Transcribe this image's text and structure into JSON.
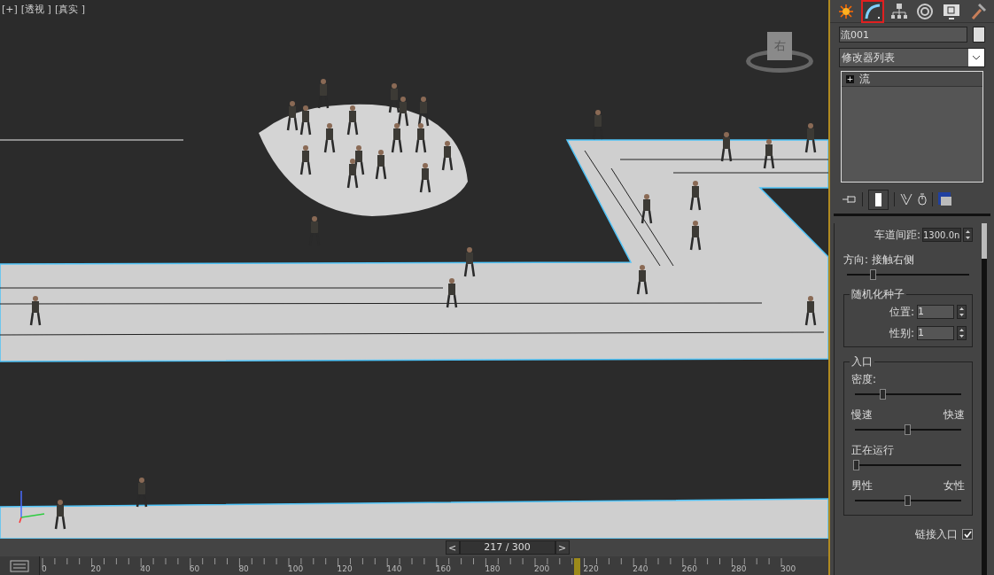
{
  "viewport": {
    "labels": [
      "[+]",
      "[透视 ]",
      "[真实 ]"
    ],
    "viewcube_label": "右"
  },
  "command_panel": {
    "tabs": [
      {
        "kind": "create",
        "selected": false
      },
      {
        "kind": "modify",
        "selected": true
      },
      {
        "kind": "hierarchy",
        "selected": false
      },
      {
        "kind": "motion",
        "selected": false
      },
      {
        "kind": "display",
        "selected": false
      },
      {
        "kind": "utilities",
        "selected": false
      }
    ],
    "object_name": "流001",
    "modifier_list": "修改器列表",
    "stack": [
      {
        "expander": "+",
        "label": "流"
      }
    ],
    "lane_spacing": {
      "label": "车道间距:",
      "value": "1300.0n"
    },
    "direction": {
      "label": "方向: 接触右侧",
      "level": 0.22
    },
    "random_seed": {
      "title": "随机化种子",
      "fields": [
        {
          "label": "位置:",
          "value": "1"
        },
        {
          "label": "性别:",
          "value": "1"
        }
      ]
    },
    "entrance": {
      "title": "入口",
      "sliders": [
        {
          "left": "密度:",
          "level": 0.27
        },
        {
          "left": "慢速",
          "right": "快速",
          "level": 0.5
        },
        {
          "left": "正在运行",
          "level": 0.02
        },
        {
          "left": "男性",
          "right": "女性",
          "level": 0.5
        }
      ]
    },
    "link_entrance": {
      "label": "链接入口",
      "checked": true
    }
  },
  "timeline": {
    "prev": "<",
    "counter": "217 / 300",
    "next": ">",
    "level": 0.723,
    "ticks": [
      "0",
      "20",
      "40",
      "60",
      "80",
      "100",
      "120",
      "140",
      "160",
      "180",
      "200",
      "220",
      "240",
      "260",
      "280",
      "300"
    ]
  }
}
